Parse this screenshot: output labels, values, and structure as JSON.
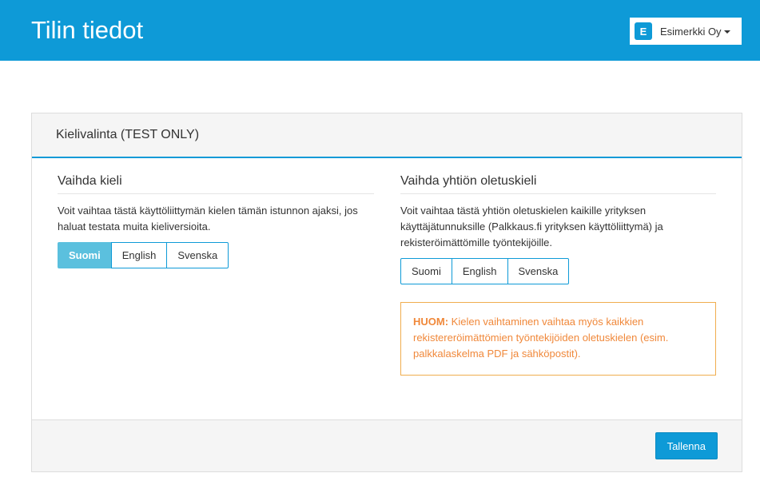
{
  "header": {
    "title": "Tilin tiedot",
    "company": {
      "avatar_letter": "E",
      "name": "Esimerkki Oy"
    }
  },
  "panel": {
    "title": "Kielivalinta (TEST ONLY)",
    "left": {
      "title": "Vaihda kieli",
      "description": "Voit vaihtaa tästä käyttöliittymän kielen tämän istunnon ajaksi, jos haluat testata muita kieliversioita.",
      "languages": [
        "Suomi",
        "English",
        "Svenska"
      ],
      "selected": "Suomi"
    },
    "right": {
      "title": "Vaihda yhtiön oletuskieli",
      "description": "Voit vaihtaa tästä yhtiön oletuskielen kaikille yrityksen käyttäjätunnuksille (Palkkaus.fi yrityksen käyttöliittymä) ja rekisteröimättömille työntekijöille.",
      "languages": [
        "Suomi",
        "English",
        "Svenska"
      ],
      "selected": null,
      "alert_label": "HUOM:",
      "alert_text": " Kielen vaihtaminen vaihtaa myös kaikkien rekistereröimättömien työntekijöiden oletuskielen (esim. palkkalaskelma PDF ja sähköpostit)."
    },
    "save_label": "Tallenna"
  },
  "colors": {
    "brand": "#0e9ad7",
    "active_button": "#5bc0de",
    "warning": "#f0ad4e"
  }
}
